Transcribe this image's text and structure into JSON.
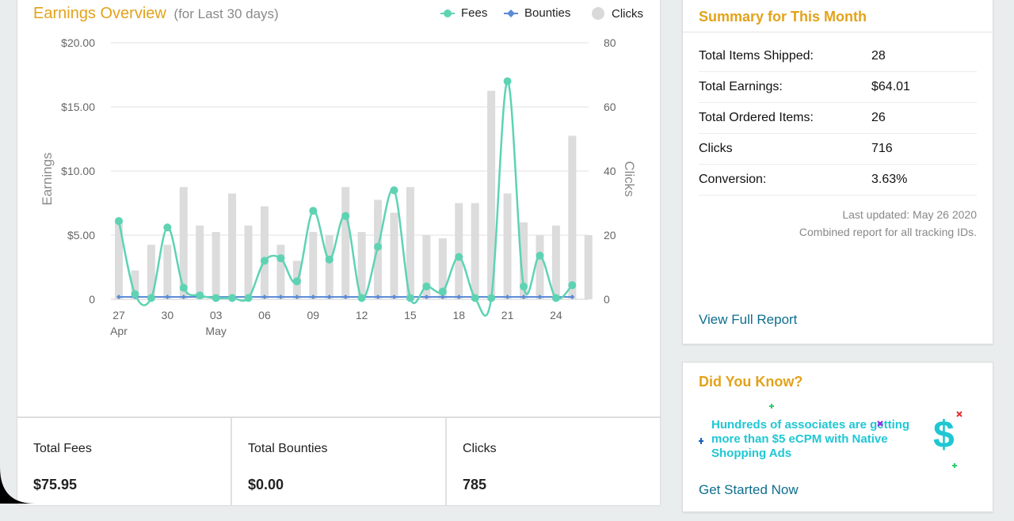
{
  "chart": {
    "title": "Earnings Overview",
    "subtitle": "(for Last 30 days)",
    "legend": [
      {
        "label": "Fees",
        "color": "#5ed3b3",
        "shape": "circle-line"
      },
      {
        "label": "Bounties",
        "color": "#5b8bd6",
        "shape": "diamond-line"
      },
      {
        "label": "Clicks",
        "color": "#d9d9d9",
        "shape": "circle"
      }
    ]
  },
  "chart_data": {
    "type": "bar+line",
    "ylabel": "Earnings",
    "y2label": "Clicks",
    "ylim": [
      0,
      20
    ],
    "y2lim": [
      0,
      80
    ],
    "y_ticks": [
      "0",
      "$5.00",
      "$10.00",
      "$15.00",
      "$20.00"
    ],
    "y2_ticks": [
      "0",
      "20",
      "40",
      "60",
      "80"
    ],
    "x_ticks": [
      {
        "index": 0,
        "label": "27",
        "sub": "Apr"
      },
      {
        "index": 3,
        "label": "30",
        "sub": ""
      },
      {
        "index": 6,
        "label": "03",
        "sub": "May"
      },
      {
        "index": 9,
        "label": "06",
        "sub": ""
      },
      {
        "index": 12,
        "label": "09",
        "sub": ""
      },
      {
        "index": 15,
        "label": "12",
        "sub": ""
      },
      {
        "index": 18,
        "label": "15",
        "sub": ""
      },
      {
        "index": 21,
        "label": "18",
        "sub": ""
      },
      {
        "index": 24,
        "label": "21",
        "sub": ""
      },
      {
        "index": 27,
        "label": "24",
        "sub": ""
      }
    ],
    "series": [
      {
        "name": "Clicks",
        "kind": "bar",
        "axis": "right",
        "values": [
          25,
          9,
          17,
          17,
          35,
          23,
          21,
          33,
          23,
          29,
          17,
          12,
          21,
          20,
          35,
          21,
          31,
          27,
          35,
          20,
          19,
          30,
          30,
          65,
          33,
          24,
          20,
          23,
          51,
          20
        ]
      },
      {
        "name": "Fees",
        "kind": "line",
        "axis": "left",
        "values": [
          6.1,
          0.4,
          0.1,
          5.6,
          0.9,
          0.3,
          0.1,
          0.1,
          0.1,
          3.0,
          3.2,
          1.4,
          6.9,
          3.1,
          6.5,
          0.1,
          4.1,
          8.5,
          0.1,
          1.0,
          0.6,
          3.3,
          0.1,
          0.1,
          17.0,
          1.0,
          3.4,
          0.1,
          1.1
        ],
        "value_offset_index": 0
      },
      {
        "name": "Bounties",
        "kind": "line",
        "axis": "left",
        "values": [
          0,
          0,
          0,
          0,
          0,
          0,
          0,
          0,
          0,
          0,
          0,
          0,
          0,
          0,
          0,
          0,
          0,
          0,
          0,
          0,
          0,
          0,
          0,
          0,
          0,
          0,
          0,
          0,
          0
        ]
      }
    ]
  },
  "totals": [
    {
      "label": "Total Fees",
      "value": "$75.95"
    },
    {
      "label": "Total Bounties",
      "value": "$0.00"
    },
    {
      "label": "Clicks",
      "value": "785"
    }
  ],
  "month": {
    "title": "Summary for This Month",
    "rows": [
      {
        "k": "Total Items Shipped:",
        "v": "28"
      },
      {
        "k": "Total Earnings:",
        "v": "$64.01"
      },
      {
        "k": "Total Ordered Items:",
        "v": "26"
      },
      {
        "k": "Clicks",
        "v": "716"
      },
      {
        "k": "Conversion:",
        "v": "3.63%"
      }
    ],
    "updated": "Last updated: May 26 2020",
    "note": "Combined report for all tracking IDs.",
    "link": "View Full Report"
  },
  "know": {
    "title": "Did You Know?",
    "promo": "Hundreds of associates are getting more than $5 eCPM with Native Shopping Ads",
    "link": "Get Started Now",
    "icon_glyph": "$"
  }
}
